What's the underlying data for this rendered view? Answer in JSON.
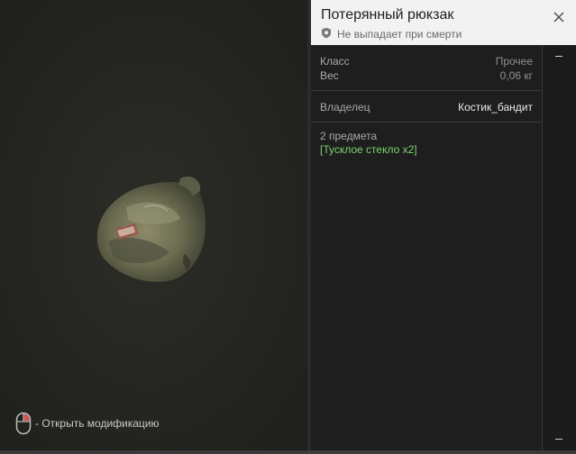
{
  "preview": {
    "hint_text": "- Открыть модификацию",
    "mouse_icon": "mouse-right-click-icon"
  },
  "header": {
    "title": "Потерянный рюкзак",
    "subtitle": "Не выпадает при смерти",
    "shield_icon": "shield-icon",
    "close_icon": "close-icon"
  },
  "stats": {
    "class_label": "Класс",
    "class_value": "Прочее",
    "weight_label": "Вес",
    "weight_value": "0,06 кг"
  },
  "owner": {
    "label": "Владелец",
    "value": "Костик_бандит"
  },
  "contents": {
    "count_text": "2 предмета",
    "item_text": "[Тусклое стекло x2]"
  },
  "colors": {
    "accent_green": "#7bd46e",
    "header_bg": "#f2f2f2",
    "panel_bg": "#1e1e1e"
  }
}
